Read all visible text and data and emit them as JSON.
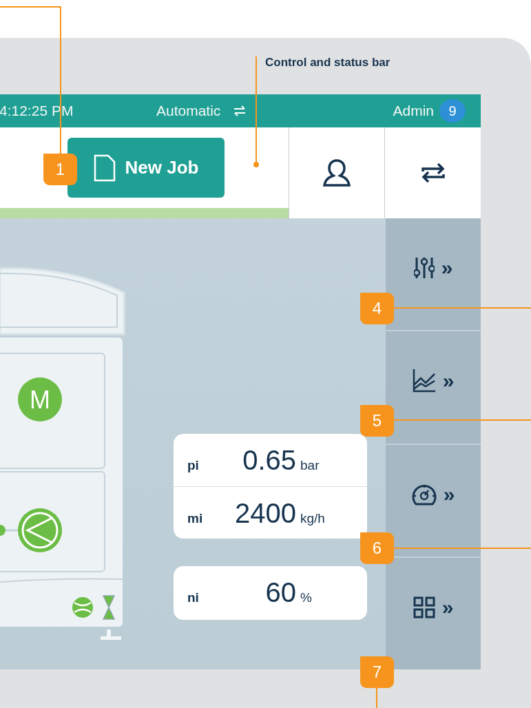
{
  "annotations": {
    "section_label": "Control and status bar",
    "callouts": [
      "1",
      "4",
      "5",
      "6",
      "7"
    ]
  },
  "status_bar": {
    "time": "4:12:25 PM",
    "mode": "Automatic",
    "user": "Admin",
    "notification_count": "9"
  },
  "toolbar": {
    "new_job_button": "New Job"
  },
  "machine": {
    "motor_label": "M"
  },
  "reading_cards": [
    {
      "rows": [
        {
          "symbol": "pi",
          "value": "0.65",
          "unit": "bar"
        },
        {
          "symbol": "mi",
          "value": "2400",
          "unit": "kg/h"
        }
      ]
    },
    {
      "rows": [
        {
          "symbol": "ni",
          "value": "60",
          "unit": "%"
        }
      ]
    }
  ],
  "sidebar": {
    "items": [
      {
        "kind": "sliders",
        "arrow": "»"
      },
      {
        "kind": "chart",
        "arrow": "»"
      },
      {
        "kind": "gauge",
        "arrow": "»"
      },
      {
        "kind": "grid",
        "arrow": "»"
      }
    ]
  }
}
